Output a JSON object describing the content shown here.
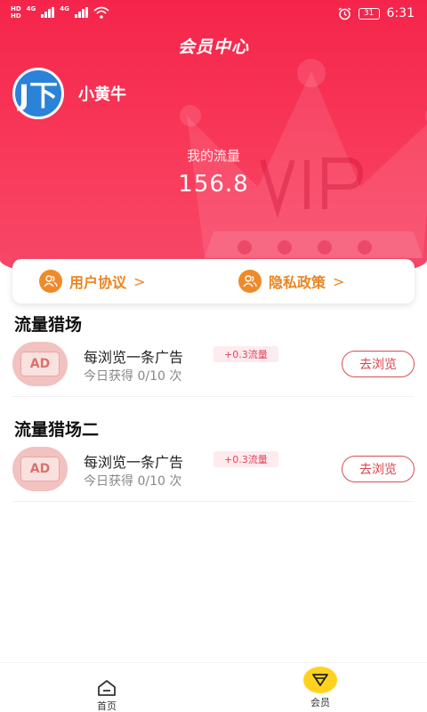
{
  "status_bar": {
    "network_badges": [
      "HD",
      "HD"
    ],
    "network_types": [
      "4G",
      "4G"
    ],
    "battery": "31",
    "time": "6:31",
    "icons": [
      "signal-icon",
      "wifi-icon",
      "alarm-icon",
      "battery-icon"
    ]
  },
  "header": {
    "title": "会员中心",
    "background_color": "#f5244b"
  },
  "user": {
    "avatar_text": "J下",
    "name": "小黄牛"
  },
  "traffic": {
    "label": "我的流量",
    "value": "156.8"
  },
  "links": {
    "user_agreement": "用户协议",
    "privacy_policy": "隐私政策",
    "chevron": ">"
  },
  "sections": [
    {
      "title": "流量猎场",
      "tasks": [
        {
          "icon_text": "AD",
          "title": "每浏览一条广告",
          "badge": "+0.3流量",
          "progress": "今日获得 0/10 次",
          "button": "去浏览"
        }
      ]
    },
    {
      "title": "流量猎场二",
      "tasks": [
        {
          "icon_text": "AD",
          "title": "每浏览一条广告",
          "badge": "+0.3流量",
          "progress": "今日获得 0/10 次",
          "button": "去浏览"
        }
      ]
    }
  ],
  "tabbar": {
    "home": "首页",
    "member": "会员",
    "active": "member",
    "active_color": "#ffd21f"
  },
  "colors": {
    "accent": "#f5244b",
    "link_orange": "#e98622",
    "button_red": "#d8424c"
  }
}
